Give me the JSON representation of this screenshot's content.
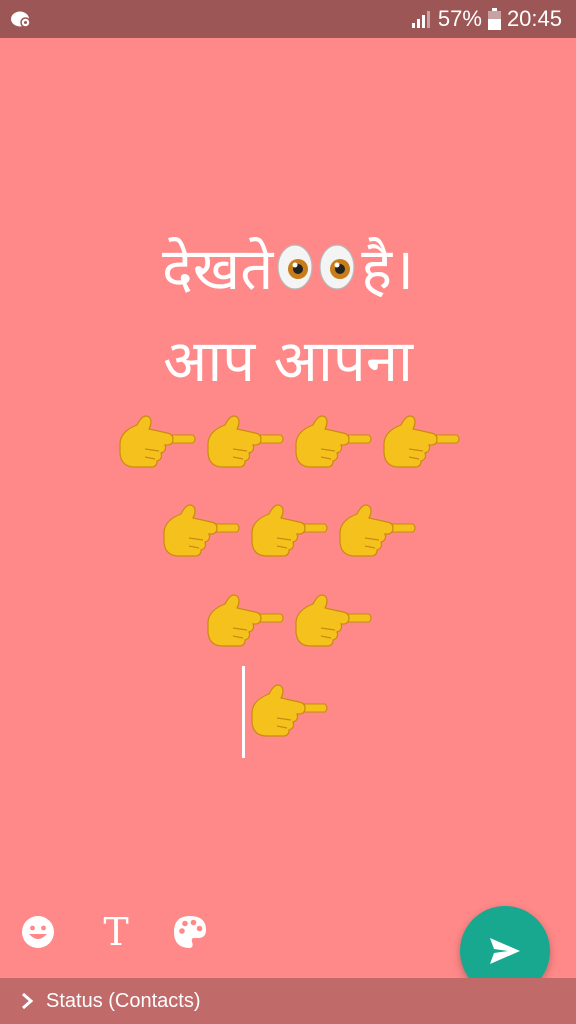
{
  "status_bar": {
    "battery_percent_text": "57%",
    "time": "20:45",
    "icons": [
      "app-notification-icon",
      "signal-icon",
      "battery-icon"
    ]
  },
  "status_text": {
    "line1_part1": "देखते",
    "line1_part2": "है।",
    "line2": "आप आपना",
    "emoji_eyes": "eyes",
    "emoji_hand": "backhand-index-pointing-right",
    "hand_rows": [
      4,
      3,
      2,
      1
    ]
  },
  "toolbar": {
    "emoji_icon": "smiley-icon",
    "text_label": "T",
    "palette_icon": "palette-icon",
    "send_icon": "send-icon"
  },
  "footer": {
    "audience_label": "Status (Contacts)"
  },
  "colors": {
    "background": "#ff8888",
    "status_bar": "#9c5656",
    "footer_bar": "#c06a6a",
    "send_button": "#17a88f",
    "text": "#ffffff"
  }
}
